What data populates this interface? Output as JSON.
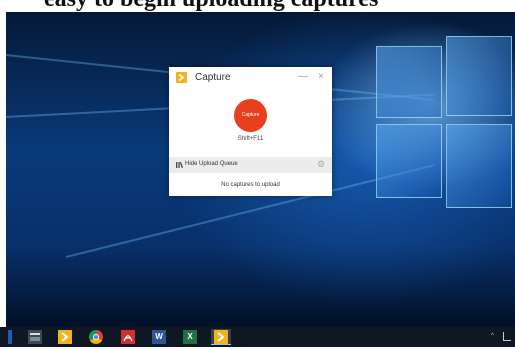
{
  "caption": "easy to begin uploading captures",
  "window": {
    "title": "Capture",
    "minimize_glyph": "—",
    "close_glyph": "×",
    "capture_button_label": "Capture",
    "shortcut": "Shift+F11",
    "queue_toggle_label": "Hide Upload Queue",
    "empty_message": "No captures to upload"
  },
  "taskbar": {
    "items": [
      {
        "icon": "calculator-icon"
      },
      {
        "icon": "capture-app-icon"
      },
      {
        "icon": "chrome-icon"
      },
      {
        "icon": "pdf-reader-icon"
      },
      {
        "icon": "word-icon",
        "glyph": "W"
      },
      {
        "icon": "excel-icon",
        "glyph": "X"
      },
      {
        "icon": "capture-app-icon",
        "active": true
      }
    ],
    "tray": [
      "^"
    ]
  },
  "colors": {
    "capture_button": "#e8401c",
    "app_icon": "#f0b41e",
    "desktop": "#0a3a7a"
  }
}
